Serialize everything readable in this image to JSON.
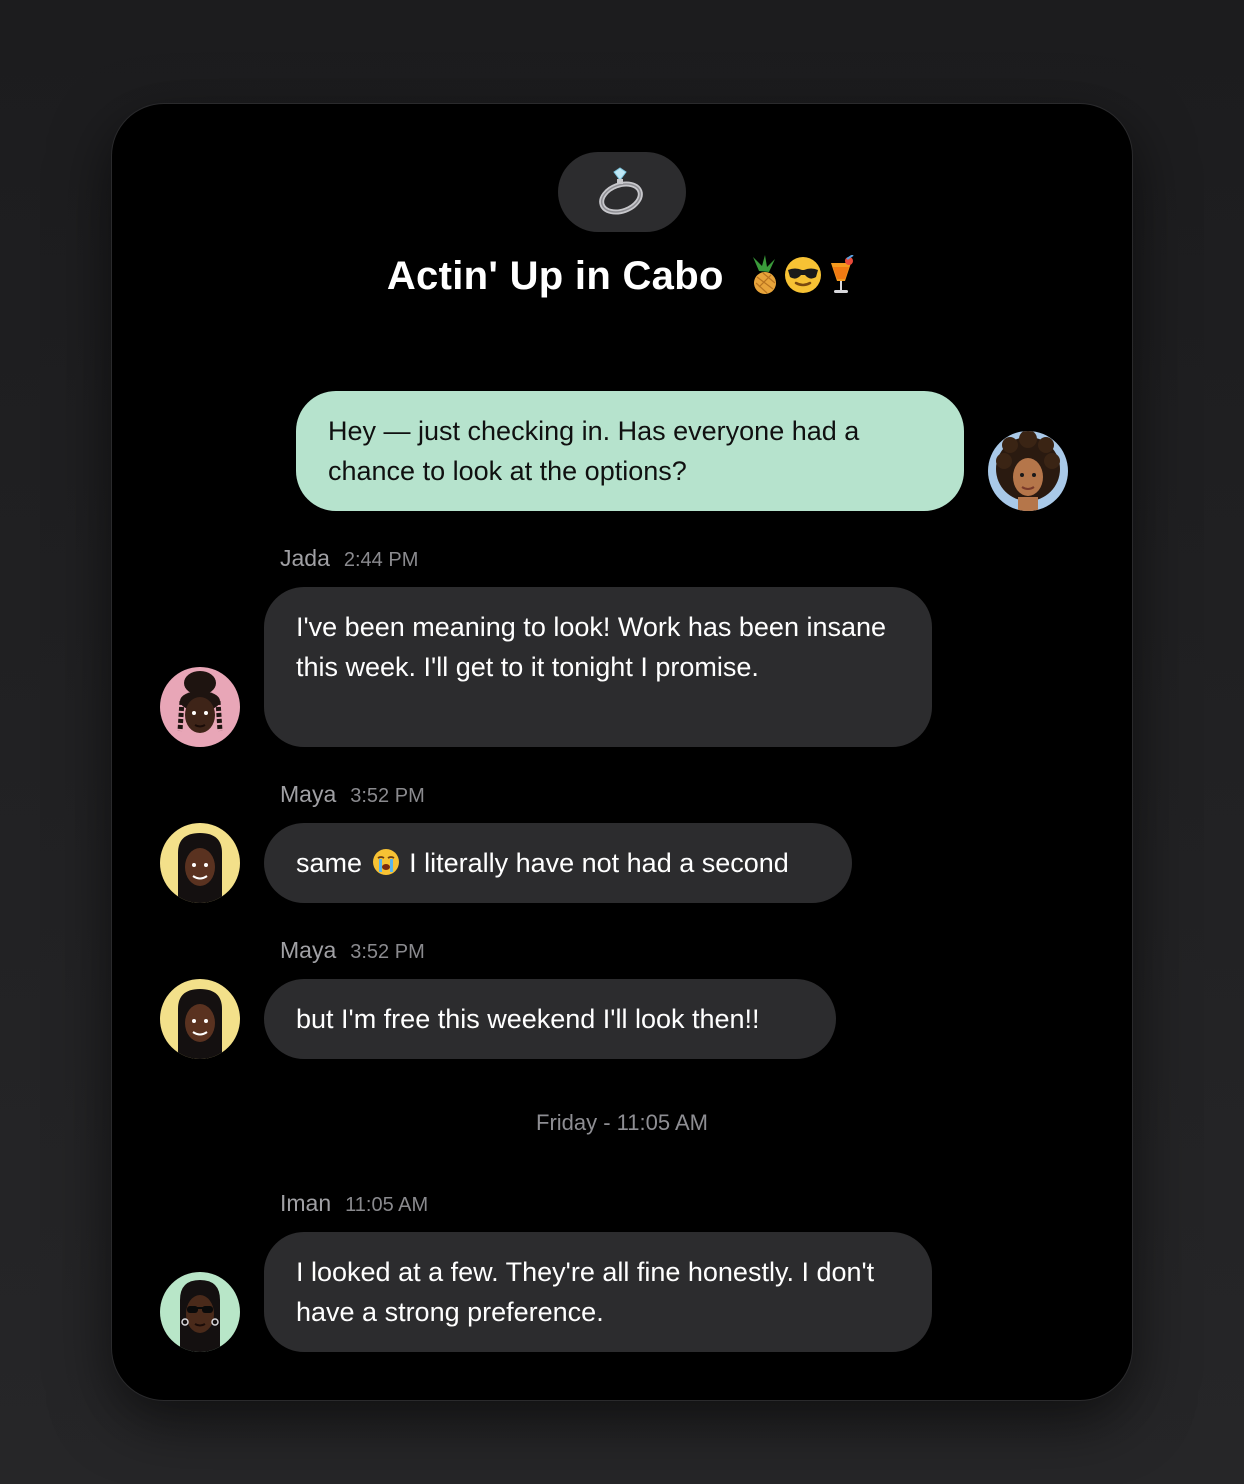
{
  "chat": {
    "title": "Actin' Up in Cabo",
    "title_emojis": [
      "pineapple-icon",
      "sunglasses-face-icon",
      "tropical-drink-icon"
    ],
    "group_icon": "ring-icon"
  },
  "messages": [
    {
      "sender": "",
      "time": "",
      "text": "Hey — just checking in. Has everyone had a chance to look at the options?",
      "mine": true
    },
    {
      "sender": "Jada",
      "time": "2:44 PM",
      "text": "I've been meaning to look! Work has been insane this week. I'll get to it tonight I promise."
    },
    {
      "sender": "Maya",
      "time": "3:52 PM",
      "text_before": "same",
      "text_after": "I literally have not had a second",
      "emoji": "loudly-crying-face-icon"
    },
    {
      "sender": "Maya",
      "time": "3:52 PM",
      "text": "but I'm free this weekend I'll look then!!"
    },
    {
      "sender": "Iman",
      "time": "11:05 AM",
      "text": "I looked at a few. They're all fine honestly. I don't have a strong preference."
    }
  ],
  "divider": "Friday - 11:05 AM",
  "colors": {
    "mine_bubble": "#b6e3cd",
    "other_bubble": "#2c2c2e",
    "jada_avatar_bg": "#e8a6b7",
    "maya_avatar_bg": "#f3e08a",
    "iman_avatar_bg": "#b8e6c8"
  }
}
